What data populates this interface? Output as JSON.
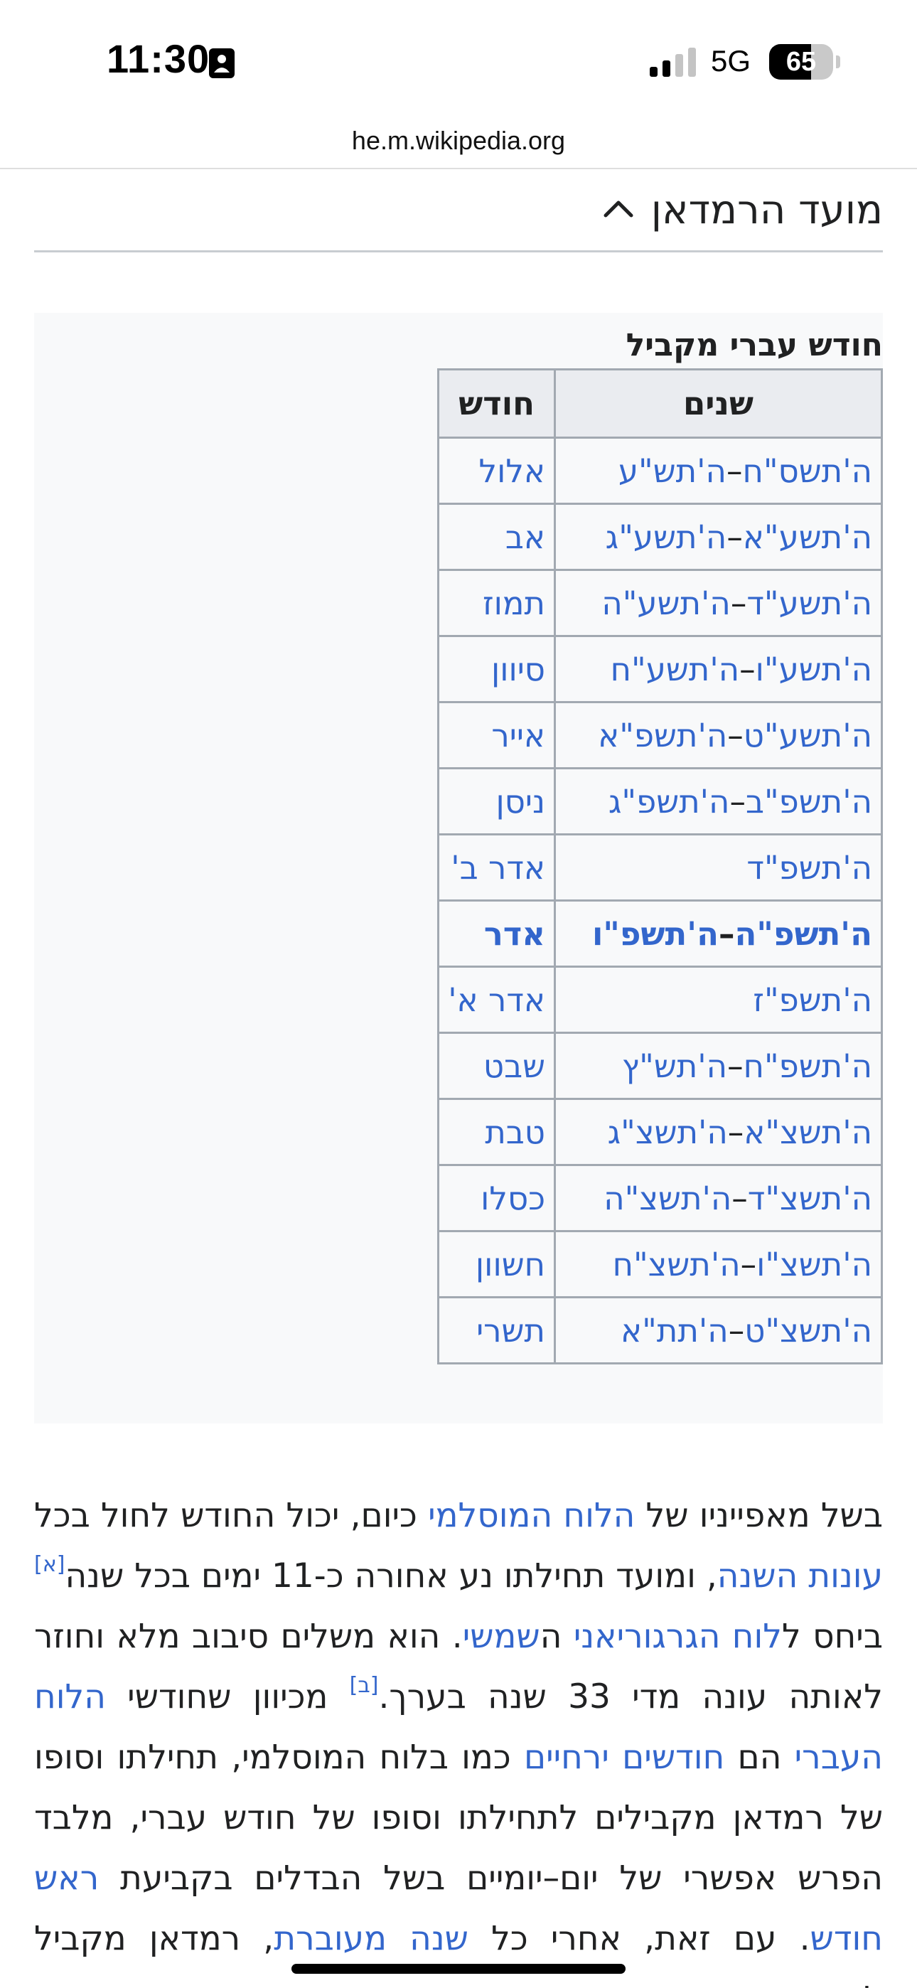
{
  "status_bar": {
    "time": "11:30",
    "network": "5G",
    "battery_level": 65,
    "battery_label": "65",
    "icons": [
      "contact-card-icon",
      "signal-bars-icon",
      "battery-icon"
    ]
  },
  "browser": {
    "url": "he.m.wikipedia.org"
  },
  "section": {
    "title": "מועד הרמדאן",
    "toggle_icon": "chevron-up-icon"
  },
  "infobox": {
    "caption": "חודש עברי מקביל",
    "headers": {
      "years": "שנים",
      "month": "חודש"
    },
    "rows": [
      {
        "years": [
          "ה'תשס\"ח",
          "ה'תש\"ע"
        ],
        "month": "אלול"
      },
      {
        "years": [
          "ה'תשע\"א",
          "ה'תשע\"ג"
        ],
        "month": "אב"
      },
      {
        "years": [
          "ה'תשע\"ד",
          "ה'תשע\"ה"
        ],
        "month": "תמוז"
      },
      {
        "years": [
          "ה'תשע\"ו",
          "ה'תשע\"ח"
        ],
        "month": "סיוון"
      },
      {
        "years": [
          "ה'תשע\"ט",
          "ה'תשפ\"א"
        ],
        "month": "אייר"
      },
      {
        "years": [
          "ה'תשפ\"ב",
          "ה'תשפ\"ג"
        ],
        "month": "ניסן"
      },
      {
        "years": [
          "ה'תשפ\"ד"
        ],
        "month": "אדר ב'"
      },
      {
        "years": [
          "ה'תשפ\"ה",
          "ה'תשפ\"ו"
        ],
        "month": "אדר",
        "current": true
      },
      {
        "years": [
          "ה'תשפ\"ז"
        ],
        "month": "אדר א'"
      },
      {
        "years": [
          "ה'תשפ\"ח",
          "ה'תש\"ץ"
        ],
        "month": "שבט"
      },
      {
        "years": [
          "ה'תשצ\"א",
          "ה'תשצ\"ג"
        ],
        "month": "טבת"
      },
      {
        "years": [
          "ה'תשצ\"ד",
          "ה'תשצ\"ה"
        ],
        "month": "כסלו"
      },
      {
        "years": [
          "ה'תשצ\"ו",
          "ה'תשצ\"ח"
        ],
        "month": "חשוון"
      },
      {
        "years": [
          "ה'תשצ\"ט",
          "ה'תת\"א"
        ],
        "month": "תשרי"
      }
    ]
  },
  "paragraph": {
    "segments": [
      {
        "text": "בשל מאפייניו של "
      },
      {
        "text": "הלוח המוסלמי",
        "link": true
      },
      {
        "text": " כיום, יכול החודש לחול בכל "
      },
      {
        "text": "עונות השנה",
        "link": true
      },
      {
        "text": ", ומועד תחילתו נע אחורה כ-11 ימים בכל שנה"
      },
      {
        "text": "[א]",
        "sup": true
      },
      {
        "text": " ביחס ל"
      },
      {
        "text": "לוח הגרגוריאני",
        "link": true
      },
      {
        "text": " ה"
      },
      {
        "text": "שמשי",
        "link": true
      },
      {
        "text": ". הוא משלים סיבוב מלא וחוזר לאותה עונה מדי 33 שנה בערך."
      },
      {
        "text": "[ב]",
        "sup": true
      },
      {
        "text": " מכיוון שחודשי "
      },
      {
        "text": "הלוח העברי",
        "link": true
      },
      {
        "text": " הם "
      },
      {
        "text": "חודשים ירחיים",
        "link": true
      },
      {
        "text": " כמו בלוח המוסלמי, תחילתו וסופו של רמדאן מקבילים לתחילתו וסופו של חודש עברי, מלבד הפרש אפשרי של יום–יומיים בשל הבדלים בקביעת "
      },
      {
        "text": "ראש חודש",
        "link": true
      },
      {
        "text": ". עם זאת, אחרי כל "
      },
      {
        "text": "שנה מעוברת",
        "link": true
      },
      {
        "text": ", רמדאן מקביל לחודש עברי אחד מוקדם יותר."
      }
    ]
  },
  "colors": {
    "link": "#3366cc",
    "text": "#202122",
    "table_border": "#a2a9b1",
    "table_header_bg": "#eaecf0",
    "infobox_bg": "#f8f9fa"
  }
}
